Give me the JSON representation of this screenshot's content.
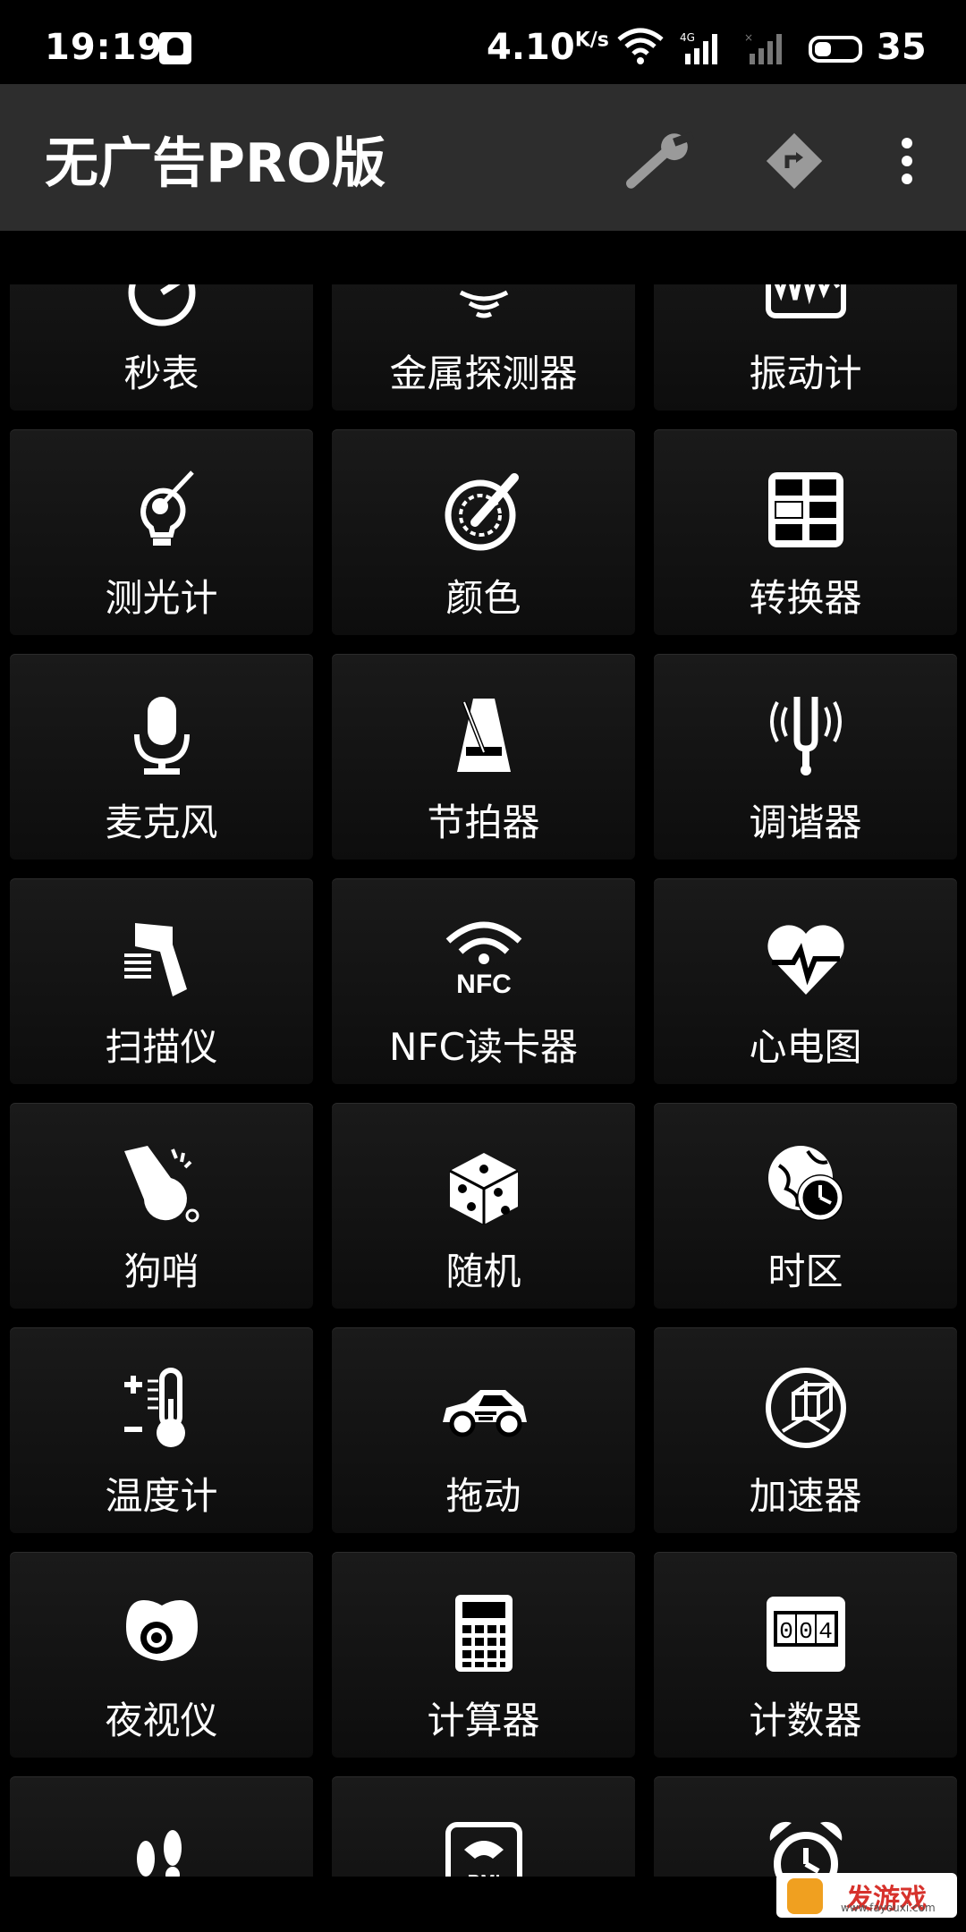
{
  "status_bar": {
    "time": "19:19",
    "net_speed": "4.10",
    "net_unit": "K/s",
    "network_type": "4G",
    "battery": "35"
  },
  "app_bar": {
    "title": "无广告PRO版",
    "actions": [
      "wrench-icon",
      "route-icon",
      "more-vertical-icon"
    ]
  },
  "tools": [
    {
      "label": "秒表",
      "icon": "stopwatch-icon"
    },
    {
      "label": "金属探测器",
      "icon": "metal-detector-icon"
    },
    {
      "label": "振动计",
      "icon": "vibrometer-icon"
    },
    {
      "label": "测光计",
      "icon": "light-meter-icon"
    },
    {
      "label": "颜色",
      "icon": "color-picker-icon"
    },
    {
      "label": "转换器",
      "icon": "converter-icon"
    },
    {
      "label": "麦克风",
      "icon": "microphone-icon"
    },
    {
      "label": "节拍器",
      "icon": "metronome-icon"
    },
    {
      "label": "调谐器",
      "icon": "tuning-fork-icon"
    },
    {
      "label": "扫描仪",
      "icon": "barcode-scanner-icon"
    },
    {
      "label": "NFC读卡器",
      "icon": "nfc-icon"
    },
    {
      "label": "心电图",
      "icon": "heart-rate-icon"
    },
    {
      "label": "狗哨",
      "icon": "whistle-icon"
    },
    {
      "label": "随机",
      "icon": "dice-icon"
    },
    {
      "label": "时区",
      "icon": "globe-clock-icon"
    },
    {
      "label": "温度计",
      "icon": "thermometer-icon"
    },
    {
      "label": "拖动",
      "icon": "car-icon"
    },
    {
      "label": "加速器",
      "icon": "accelerometer-icon"
    },
    {
      "label": "夜视仪",
      "icon": "night-vision-icon"
    },
    {
      "label": "计算器",
      "icon": "calculator-icon"
    },
    {
      "label": "计数器",
      "icon": "counter-icon"
    },
    {
      "label": "",
      "icon": "footsteps-icon"
    },
    {
      "label": "",
      "icon": "bmi-scale-icon"
    },
    {
      "label": "",
      "icon": "alarm-clock-icon"
    }
  ],
  "watermark": {
    "text": "发游戏",
    "url": "www.fayouxi.com"
  }
}
